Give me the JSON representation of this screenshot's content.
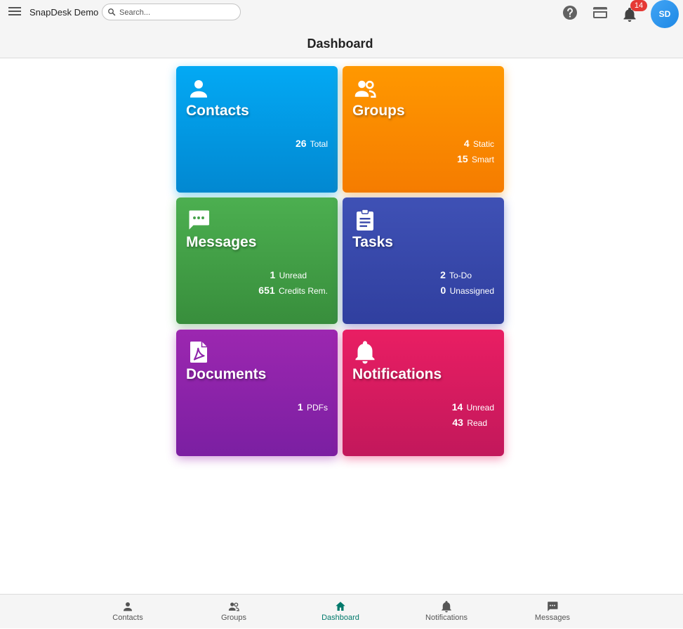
{
  "header": {
    "app_name": "SnapDesk Demo",
    "search_placeholder": "Search...",
    "notification_count": "14",
    "avatar_initials": "SD",
    "icons": [
      "menu-icon",
      "search-icon",
      "help-icon",
      "credit-card-icon",
      "bell-icon"
    ]
  },
  "page": {
    "title": "Dashboard"
  },
  "tiles": [
    {
      "title": "Contacts",
      "icon": "person-icon",
      "color": "#03a9f4",
      "stats": [
        {
          "value": "26",
          "label": "Total"
        }
      ]
    },
    {
      "title": "Groups",
      "icon": "people-icon",
      "color": "#ff9800",
      "stats": [
        {
          "value": "4",
          "label": "Static"
        },
        {
          "value": "15",
          "label": "Smart"
        }
      ]
    },
    {
      "title": "Messages",
      "icon": "chat-icon",
      "color": "#4caf50",
      "stats": [
        {
          "value": "1",
          "label": "Unread"
        },
        {
          "value": "651",
          "label": "Credits Rem."
        }
      ]
    },
    {
      "title": "Tasks",
      "icon": "clipboard-icon",
      "color": "#3f51b5",
      "stats": [
        {
          "value": "2",
          "label": "To-Do"
        },
        {
          "value": "0",
          "label": "Unassigned"
        }
      ]
    },
    {
      "title": "Documents",
      "icon": "pdf-icon",
      "color": "#9c27b0",
      "stats": [
        {
          "value": "1",
          "label": "PDFs"
        }
      ]
    },
    {
      "title": "Notifications",
      "icon": "bell-icon",
      "color": "#e91e63",
      "stats": [
        {
          "value": "14",
          "label": "Unread"
        },
        {
          "value": "43",
          "label": "Read"
        }
      ]
    }
  ],
  "bottom_nav": [
    {
      "label": "Contacts",
      "icon": "person-icon"
    },
    {
      "label": "Groups",
      "icon": "people-icon"
    },
    {
      "label": "Dashboard",
      "icon": "home-icon",
      "active": true
    },
    {
      "label": "Notifications",
      "icon": "bell-icon"
    },
    {
      "label": "Messages",
      "icon": "chat-icon"
    }
  ],
  "colors": {
    "active_nav": "#00796b",
    "badge": "#e53935"
  }
}
